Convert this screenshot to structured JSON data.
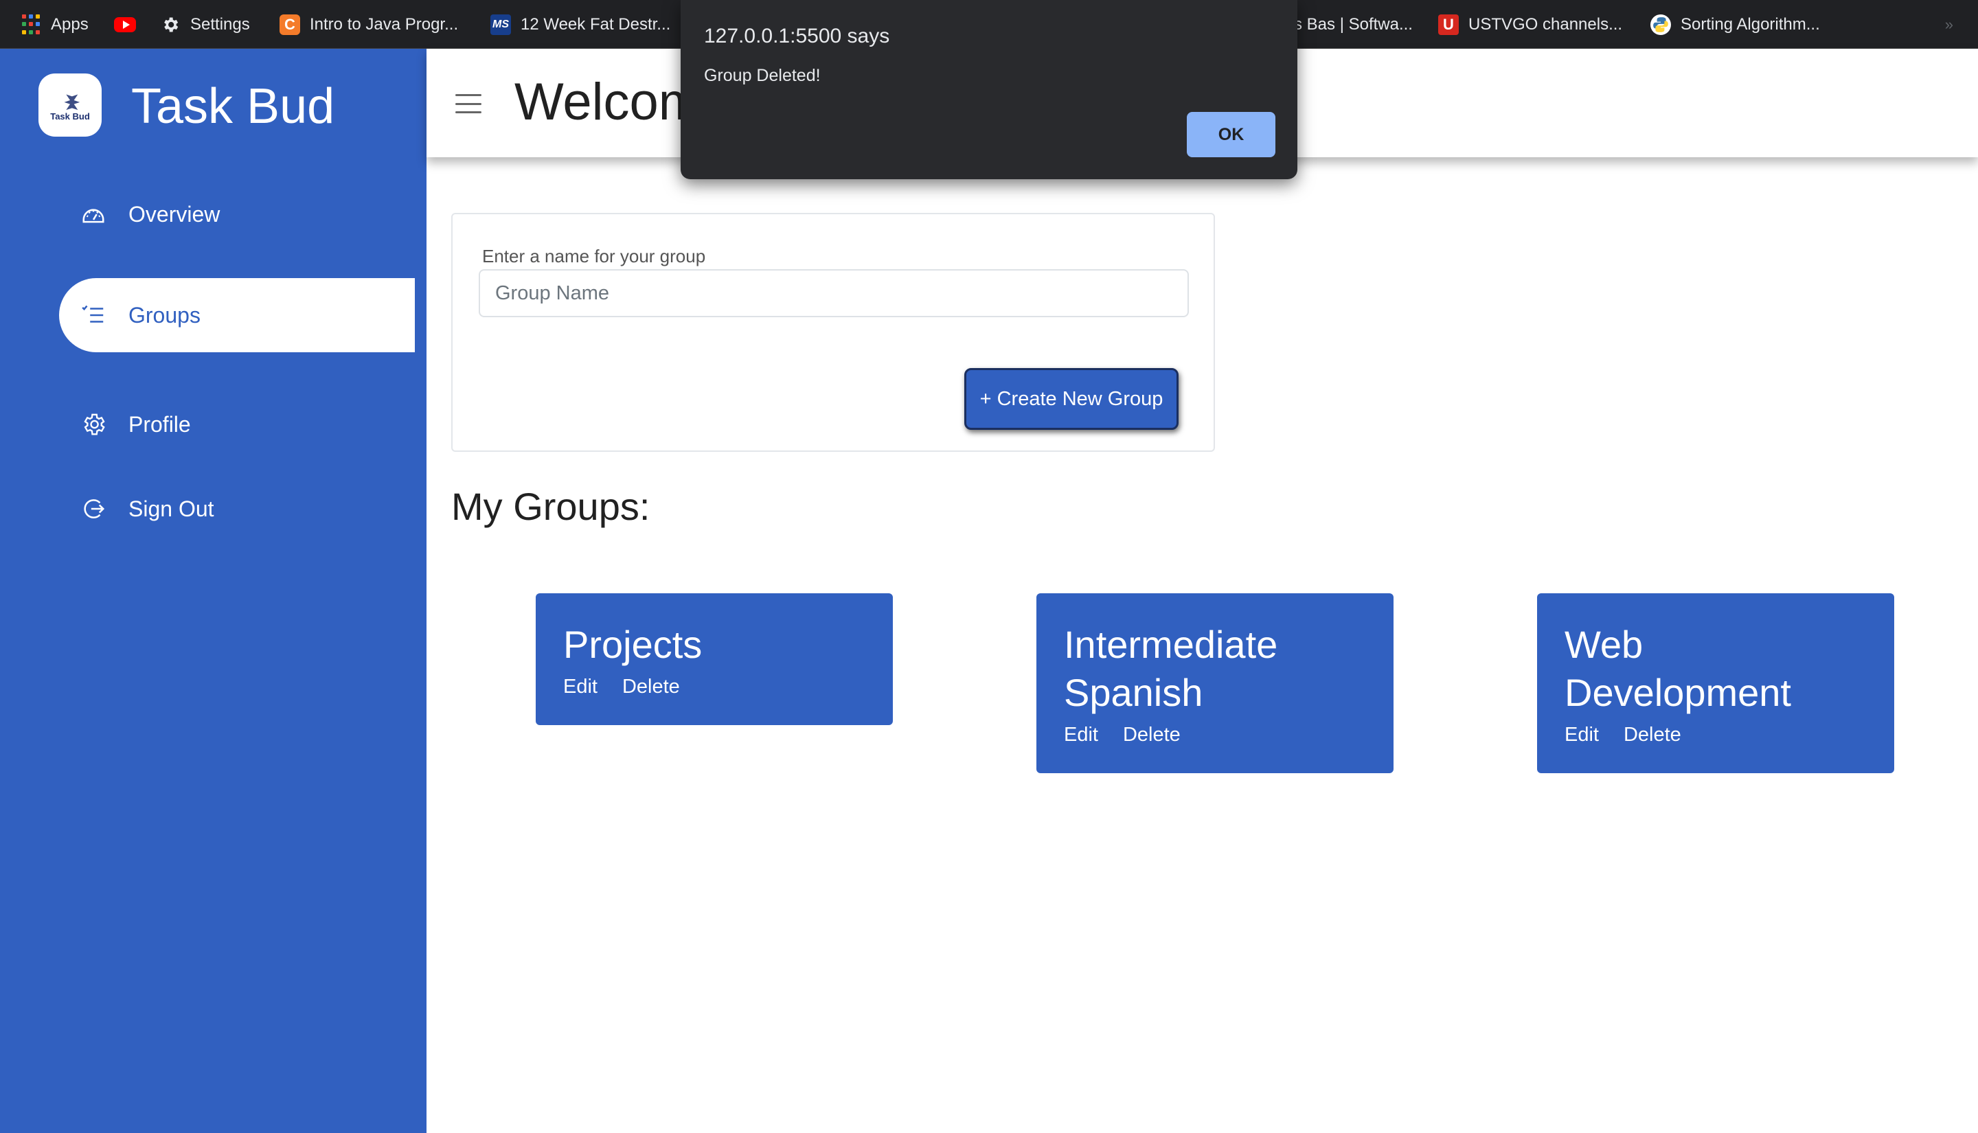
{
  "bookmarks": {
    "apps": "Apps",
    "settings": "Settings",
    "java": "Intro to Java Progr...",
    "fat": "12 Week Fat Destr...",
    "bas": "s Bas | Softwa...",
    "ustvgo": "USTVGO channels...",
    "sorting": "Sorting Algorithm...",
    "more": "»"
  },
  "brand": {
    "logo_text": "Task Bud",
    "name": "Task Bud"
  },
  "nav": {
    "overview": "Overview",
    "groups": "Groups",
    "profile": "Profile",
    "signout": "Sign Out"
  },
  "header": {
    "title": "Welcom"
  },
  "create": {
    "label": "Enter a name for your group",
    "placeholder": "Group Name",
    "button": "+ Create New Group"
  },
  "groups_heading": "My Groups:",
  "groups": [
    {
      "title": "Projects",
      "edit": "Edit",
      "delete": "Delete"
    },
    {
      "title": "Intermediate Spanish",
      "edit": "Edit",
      "delete": "Delete"
    },
    {
      "title": "Web Development",
      "edit": "Edit",
      "delete": "Delete"
    }
  ],
  "alert": {
    "title": "127.0.0.1:5500 says",
    "message": "Group Deleted!",
    "ok": "OK"
  },
  "colors": {
    "brand_blue": "#3160c0",
    "alert_bg": "#292a2d",
    "alert_button": "#8ab4f8"
  }
}
